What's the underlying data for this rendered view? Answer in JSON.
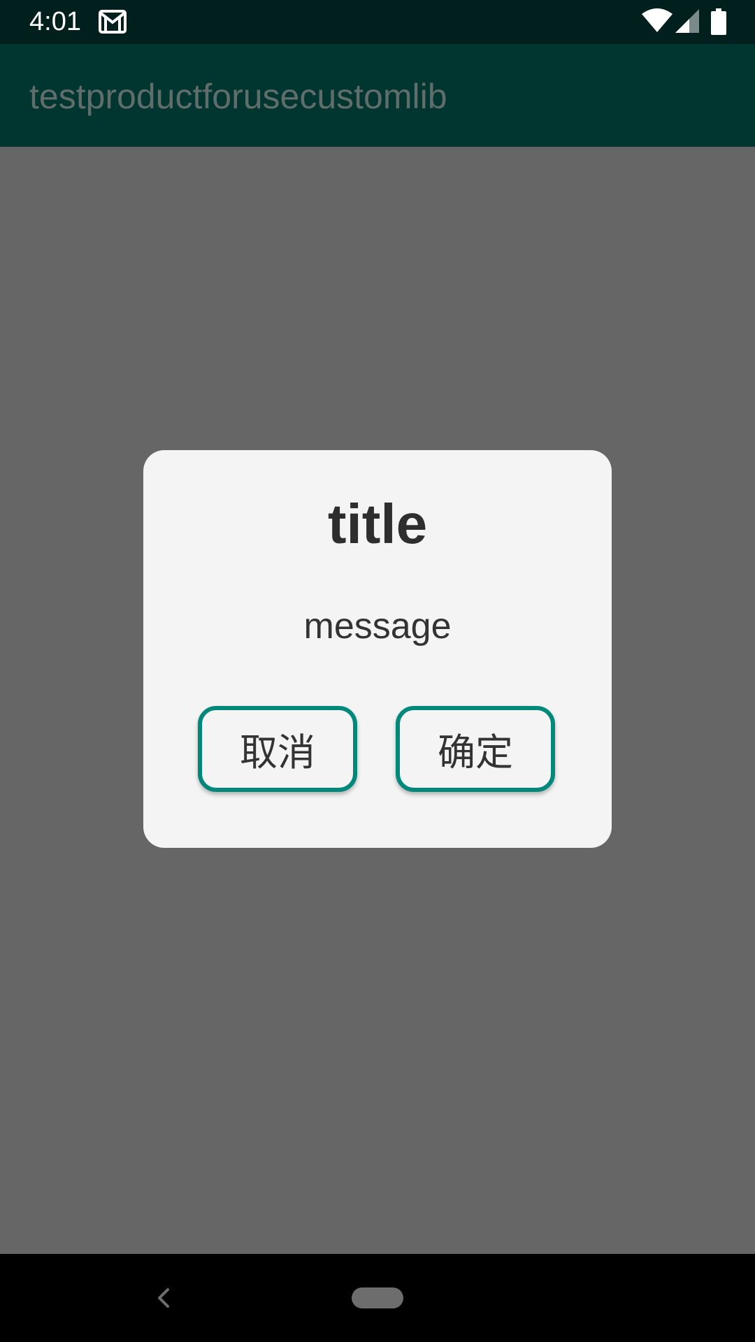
{
  "status_bar": {
    "time": "4:01",
    "icons": [
      "gmail-icon",
      "wifi-icon",
      "signal-icon",
      "battery-icon"
    ]
  },
  "app_bar": {
    "title": "testproductforusecustomlib"
  },
  "dialog": {
    "title": "title",
    "message": "message",
    "cancel_label": "取消",
    "confirm_label": "确定"
  },
  "nav_bar": {
    "icons": [
      "back-icon",
      "home-pill-icon"
    ]
  },
  "colors": {
    "status_bar_bg": "#01201d",
    "app_bar_bg": "#003530",
    "scrim": "#666666",
    "dialog_bg": "#f4f4f4",
    "button_border": "#00897b"
  }
}
